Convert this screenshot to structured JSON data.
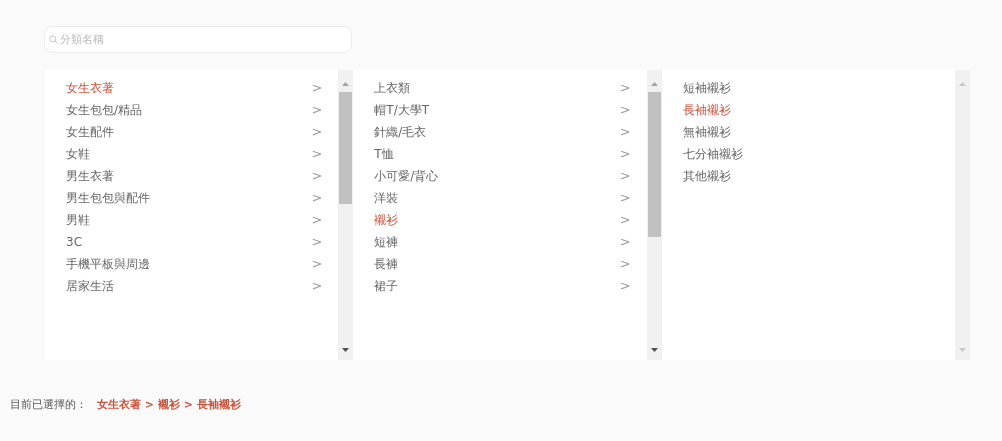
{
  "search": {
    "placeholder": "分類名稱"
  },
  "columns": [
    {
      "scrollable": true,
      "items": [
        {
          "label": "女生衣著",
          "selected": true,
          "arrow": ">"
        },
        {
          "label": "女生包包/精品",
          "selected": false,
          "arrow": ">"
        },
        {
          "label": "女生配件",
          "selected": false,
          "arrow": ">"
        },
        {
          "label": "女鞋",
          "selected": false,
          "arrow": ">"
        },
        {
          "label": "男生衣著",
          "selected": false,
          "arrow": ">"
        },
        {
          "label": "男生包包與配件",
          "selected": false,
          "arrow": ">"
        },
        {
          "label": "男鞋",
          "selected": false,
          "arrow": ">"
        },
        {
          "label": "3C",
          "selected": false,
          "arrow": ">"
        },
        {
          "label": "手機平板與周邊",
          "selected": false,
          "arrow": ">"
        },
        {
          "label": "居家生活",
          "selected": false,
          "arrow": ">"
        }
      ]
    },
    {
      "scrollable": true,
      "items": [
        {
          "label": "上衣類",
          "selected": false,
          "arrow": ">"
        },
        {
          "label": "帽T/大學T",
          "selected": false,
          "arrow": ">"
        },
        {
          "label": "針織/毛衣",
          "selected": false,
          "arrow": ">"
        },
        {
          "label": "T恤",
          "selected": false,
          "arrow": ">"
        },
        {
          "label": "小可愛/背心",
          "selected": false,
          "arrow": ">"
        },
        {
          "label": "洋裝",
          "selected": false,
          "arrow": ">"
        },
        {
          "label": "襯衫",
          "selected": true,
          "arrow": ">"
        },
        {
          "label": "短褲",
          "selected": false,
          "arrow": ">"
        },
        {
          "label": "長褲",
          "selected": false,
          "arrow": ">"
        },
        {
          "label": "裙子",
          "selected": false,
          "arrow": ">"
        }
      ]
    },
    {
      "scrollable": false,
      "items": [
        {
          "label": "短袖襯衫",
          "selected": false
        },
        {
          "label": "長袖襯衫",
          "selected": true
        },
        {
          "label": "無袖襯衫",
          "selected": false
        },
        {
          "label": "七分袖襯衫",
          "selected": false
        },
        {
          "label": "其他襯衫",
          "selected": false
        }
      ]
    }
  ],
  "selection": {
    "label": "目前已選擇的：",
    "path": "女生衣著 > 襯衫 > 長袖襯衫"
  }
}
